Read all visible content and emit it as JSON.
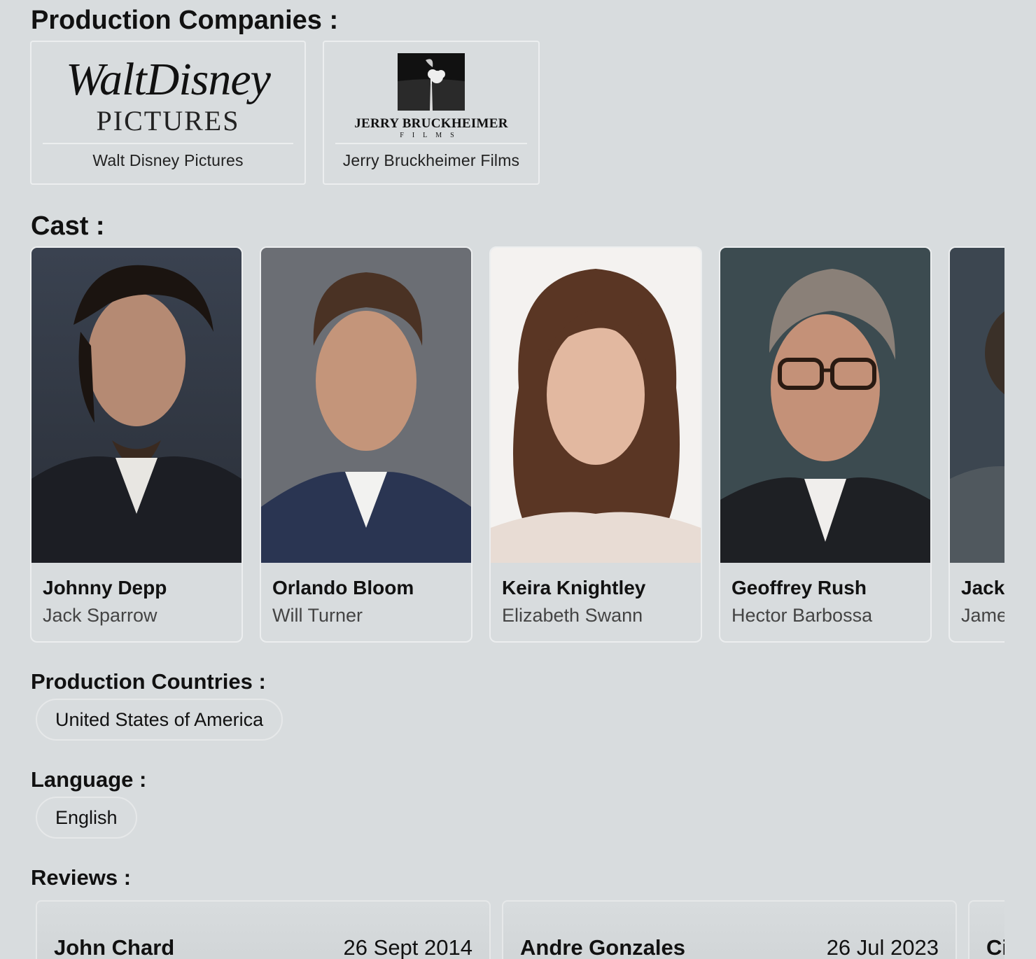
{
  "sections": {
    "companies_title": "Production Companies :",
    "cast_title": "Cast :",
    "countries_title": "Production Countries :",
    "language_title": "Language :",
    "reviews_title": "Reviews :"
  },
  "companies": [
    {
      "name": "Walt Disney Pictures",
      "logo_text_1": "WaltDisney",
      "logo_text_2": "PICTURES"
    },
    {
      "name": "Jerry Bruckheimer Films",
      "logo_text_1": "JERRY BRUCKHEIMER",
      "logo_text_2": "FILMS"
    }
  ],
  "cast": [
    {
      "name": "Johnny Depp",
      "role": "Jack Sparrow"
    },
    {
      "name": "Orlando Bloom",
      "role": "Will Turner"
    },
    {
      "name": "Keira Knightley",
      "role": "Elizabeth Swann"
    },
    {
      "name": "Geoffrey Rush",
      "role": "Hector Barbossa"
    },
    {
      "name": "Jack",
      "role": "Jame"
    }
  ],
  "countries": [
    "United States of America"
  ],
  "languages": [
    "English"
  ],
  "reviews": [
    {
      "author": "John Chard",
      "date": "26 Sept 2014"
    },
    {
      "author": "Andre Gonzales",
      "date": "26 Jul 2023"
    },
    {
      "author": "Ci",
      "date": ""
    }
  ],
  "colors": {
    "background": "#d8dcde",
    "card_border": "#eceeef",
    "text": "#111111",
    "muted": "#444444"
  }
}
